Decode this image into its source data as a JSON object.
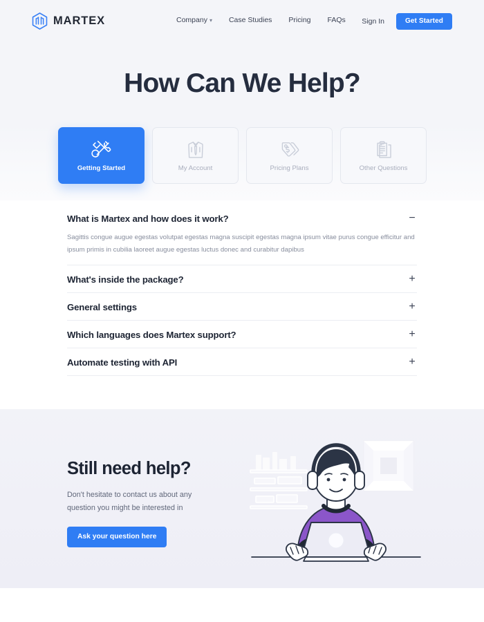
{
  "brand": {
    "name": "MARTEX",
    "logo_icon": "hexagon-cube-icon",
    "accent_color": "#2f7df4",
    "dark_color": "#1d2433"
  },
  "nav": {
    "links": [
      {
        "label": "Company",
        "has_dropdown": true,
        "caret": "▾"
      },
      {
        "label": "Case Studies",
        "has_dropdown": false
      },
      {
        "label": "Pricing",
        "has_dropdown": false
      },
      {
        "label": "FAQs",
        "has_dropdown": false
      }
    ],
    "signin_label": "Sign In",
    "cta_label": "Get Started"
  },
  "hero": {
    "title": "How Can We Help?"
  },
  "categories": [
    {
      "label": "Getting Started",
      "icon": "tools-wrench-screwdriver-icon",
      "active": true
    },
    {
      "label": "My Account",
      "icon": "shirt-tie-icon",
      "active": false
    },
    {
      "label": "Pricing Plans",
      "icon": "price-tag-dollar-icon",
      "active": false
    },
    {
      "label": "Other Questions",
      "icon": "clipboard-document-icon",
      "active": false
    }
  ],
  "faq": {
    "items": [
      {
        "question": "What is Martex and how does it work?",
        "answer": "Sagittis congue augue egestas volutpat egestas magna suscipit egestas magna ipsum vitae purus congue efficitur and ipsum primis in cubilia laoreet augue egestas luctus donec and curabitur dapibus",
        "expanded": true,
        "toggle": "−"
      },
      {
        "question": "What's inside the package?",
        "answer": "",
        "expanded": false,
        "toggle": "+"
      },
      {
        "question": "General settings",
        "answer": "",
        "expanded": false,
        "toggle": "+"
      },
      {
        "question": "Which languages does Martex support?",
        "answer": "",
        "expanded": false,
        "toggle": "+"
      },
      {
        "question": "Automate testing with API",
        "answer": "",
        "expanded": false,
        "toggle": "+"
      }
    ]
  },
  "help": {
    "title": "Still need help?",
    "subtitle": "Don't hesitate to contact us about any question you might be interested in",
    "button_label": "Ask your question here",
    "illustration": "support-agent-with-headset-at-laptop-illustration"
  }
}
